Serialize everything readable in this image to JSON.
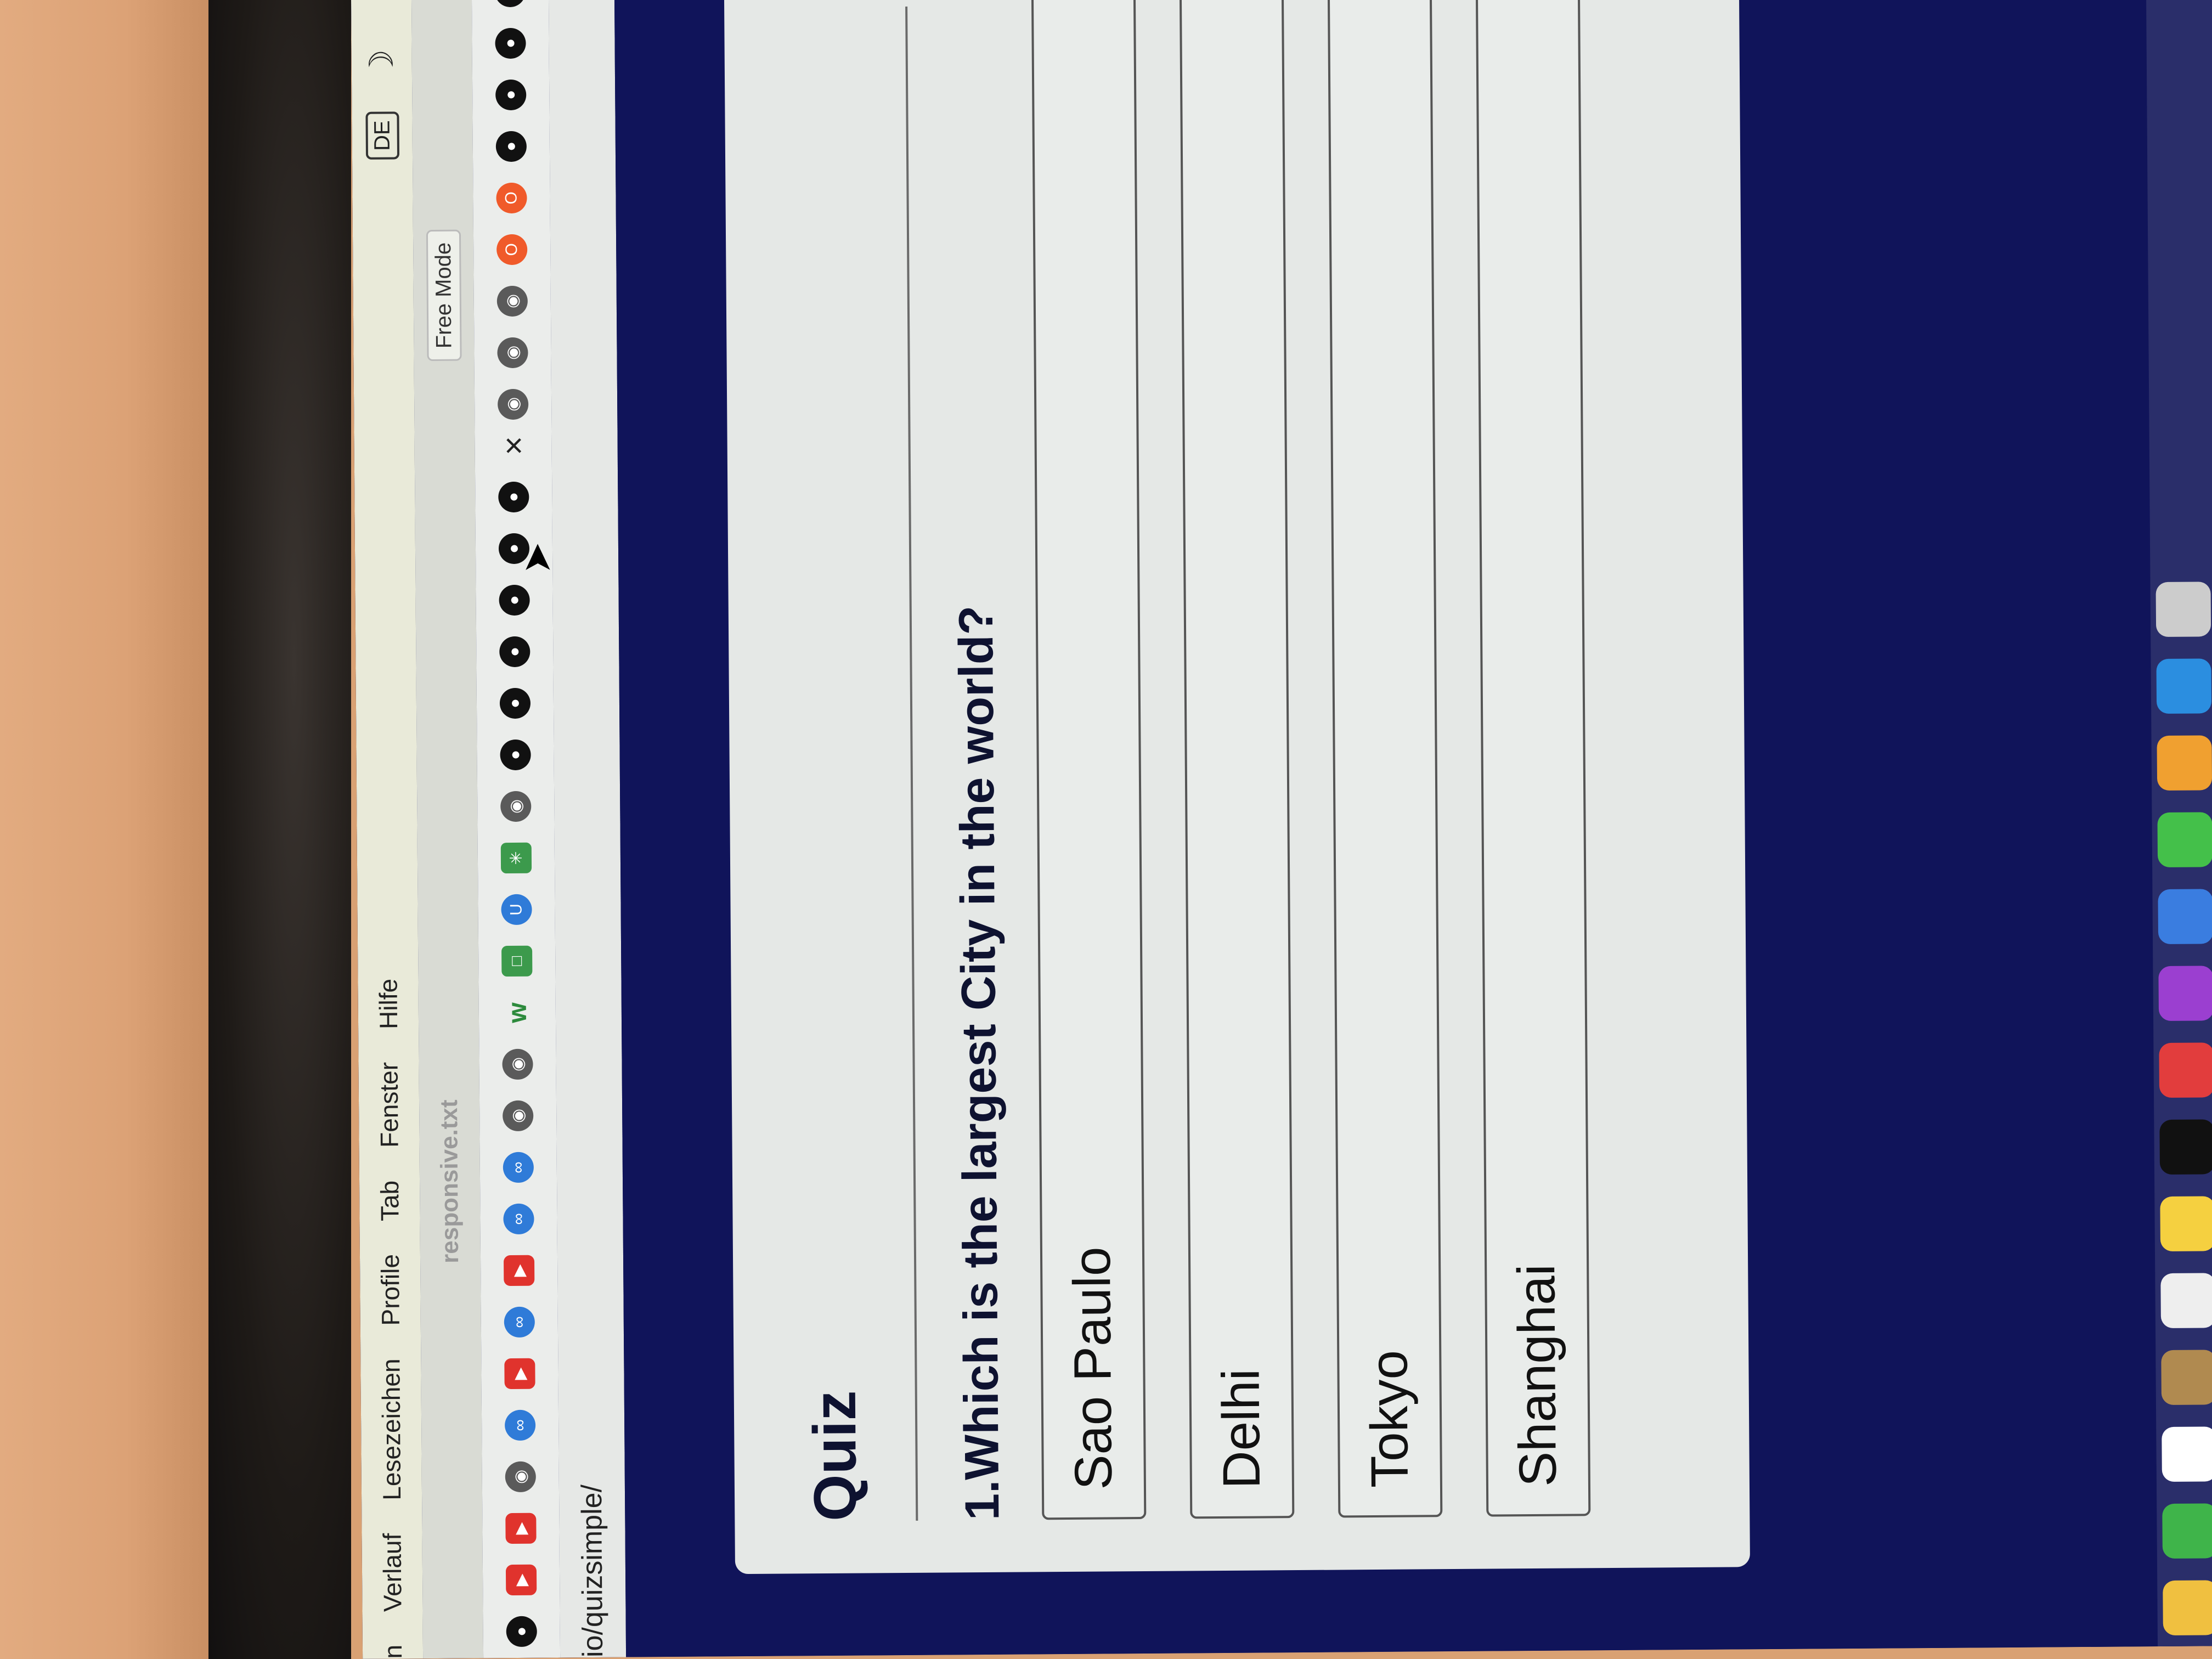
{
  "menubar": {
    "partial_item": "n",
    "items": [
      "Verlauf",
      "Lesezeichen",
      "Profile",
      "Tab",
      "Fenster",
      "Hilfe"
    ],
    "input_source": "DE"
  },
  "tab": {
    "title": "responsive.txt",
    "mode_button": "Free Mode"
  },
  "toolbar": {
    "close_label": "×"
  },
  "url": {
    "text": "io/quizsimple/"
  },
  "quiz": {
    "title": "Quiz",
    "question": "1.Which is the largest City in the world?",
    "answers": [
      "Sao Paulo",
      "Delhi",
      "Tokyo",
      "Shanghai"
    ]
  },
  "colors": {
    "page_background": "#10145a",
    "card_background": "#e5e8e6",
    "menubar": "#e9ead9"
  }
}
